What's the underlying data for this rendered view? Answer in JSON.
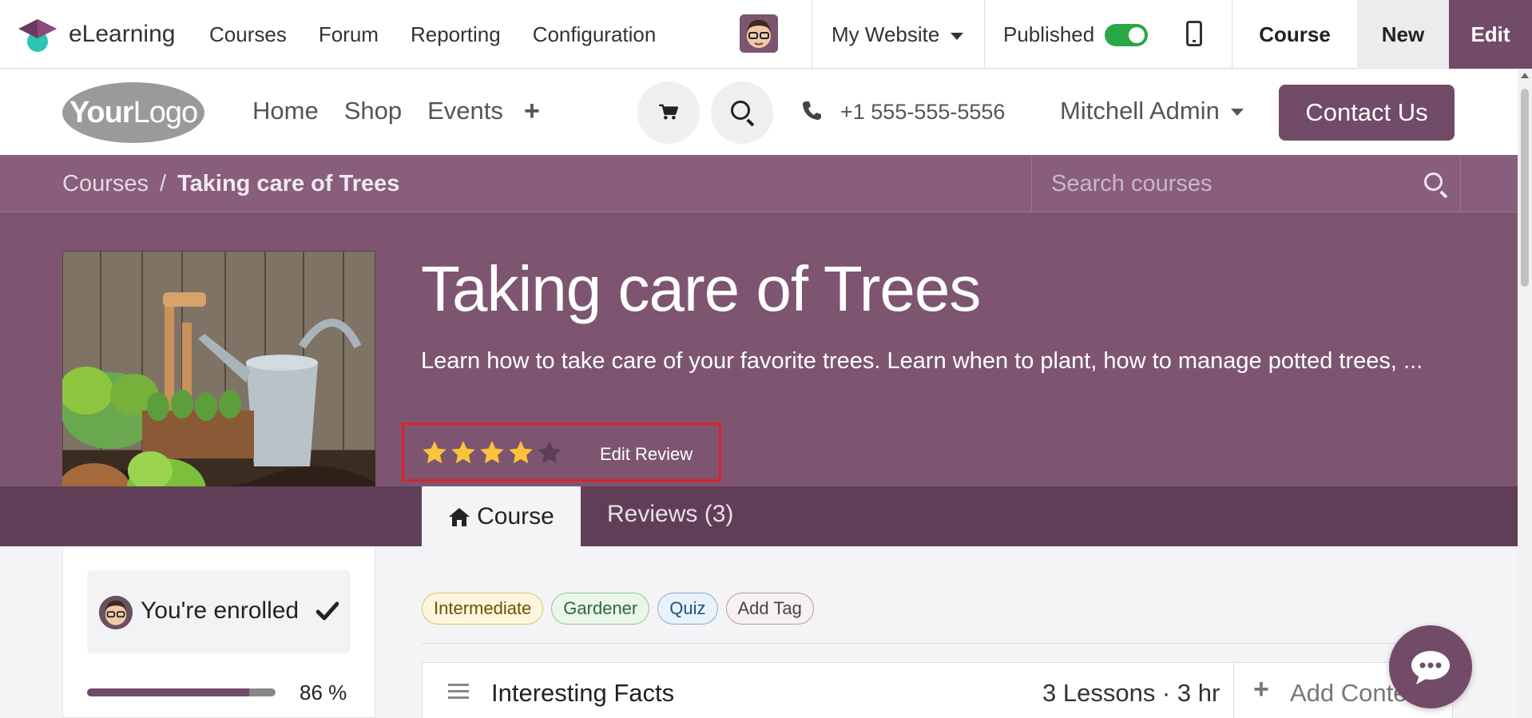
{
  "admin_bar": {
    "app_name": "eLearning",
    "menu": [
      "Courses",
      "Forum",
      "Reporting",
      "Configuration"
    ],
    "website_selector": "My Website",
    "published_label": "Published",
    "published": true,
    "course_button": "Course",
    "new_button": "New",
    "edit_button": "Edit"
  },
  "site_header": {
    "logo_text_bold": "Your",
    "logo_text_light": "Logo",
    "nav": [
      "Home",
      "Shop",
      "Events"
    ],
    "phone": "+1 555-555-5556",
    "user": "Mitchell Admin",
    "contact_button": "Contact Us"
  },
  "breadcrumb": {
    "root": "Courses",
    "separator": "/",
    "current": "Taking care of Trees"
  },
  "search": {
    "placeholder": "Search courses"
  },
  "course": {
    "title": "Taking care of Trees",
    "description": "Learn how to take care of your favorite trees. Learn when to plant, how to manage potted trees, ...",
    "rating": 4,
    "rating_max": 5,
    "edit_review_label": "Edit Review"
  },
  "tabs": {
    "course": "Course",
    "reviews": "Reviews (3)"
  },
  "enrollment": {
    "status": "You're enrolled",
    "progress": 86,
    "progress_text": "86 %"
  },
  "tags": {
    "intermediate": "Intermediate",
    "gardener": "Gardener",
    "quiz": "Quiz",
    "add": "Add Tag"
  },
  "section": {
    "title": "Interesting Facts",
    "meta": "3 Lessons · 3 hr",
    "add_content": "Add Content"
  },
  "colors": {
    "brand": "#714b67",
    "hero": "#7d5571",
    "star": "#f9c33a",
    "highlight": "#e0202a",
    "toggle_on": "#28a745"
  },
  "icons": [
    "graduation-cap-icon",
    "caret-down-icon",
    "mobile-icon",
    "plus-icon",
    "cart-icon",
    "search-icon",
    "phone-icon",
    "star-icon",
    "home-icon",
    "check-icon",
    "drag-handle-icon",
    "chat-icon"
  ]
}
